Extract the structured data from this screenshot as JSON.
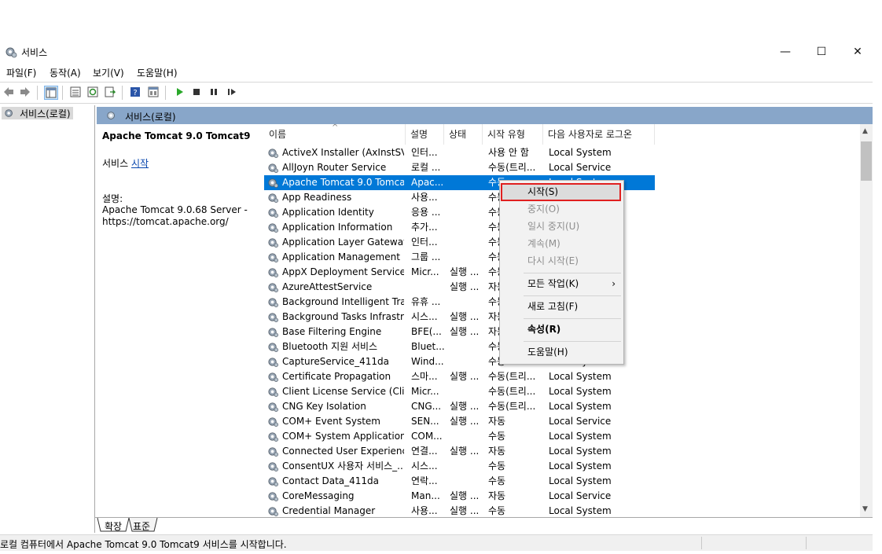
{
  "window": {
    "title": "서비스",
    "minimize": "—",
    "maximize": "☐",
    "close": "✕"
  },
  "menu": [
    "파일(F)",
    "동작(A)",
    "보기(V)",
    "도움말(H)"
  ],
  "tree": {
    "root_label": "서비스(로컬)"
  },
  "panel": {
    "header_label": "서비스(로컬)"
  },
  "detail": {
    "service_name": "Apache Tomcat 9.0 Tomcat9",
    "action_prefix": "서비스",
    "action_link": "시작",
    "desc_label": "설명:",
    "desc_line1": "Apache Tomcat 9.0.68 Server -",
    "desc_line2": "https://tomcat.apache.org/"
  },
  "columns": {
    "name": "이름",
    "desc": "설명",
    "status": "상태",
    "startup": "시작 유형",
    "logon": "다음 사용자로 로그온"
  },
  "services": [
    {
      "name": "ActiveX Installer (AxInstSV)",
      "desc": "인터...",
      "status": "",
      "startup": "사용 안 함",
      "logon": "Local System"
    },
    {
      "name": "AllJoyn Router Service",
      "desc": "로컬 ...",
      "status": "",
      "startup": "수동(트리...",
      "logon": "Local Service"
    },
    {
      "name": "Apache Tomcat 9.0 Tomcat9",
      "desc": "Apac...",
      "status": "",
      "startup": "수동",
      "logon": "Local System",
      "selected": true
    },
    {
      "name": "App Readiness",
      "desc": "사용...",
      "status": "",
      "startup": "수동",
      "logon": ""
    },
    {
      "name": "Application Identity",
      "desc": "응용 ...",
      "status": "",
      "startup": "수동",
      "logon": ""
    },
    {
      "name": "Application Information",
      "desc": "추가...",
      "status": "",
      "startup": "수동",
      "logon": ""
    },
    {
      "name": "Application Layer Gateway ...",
      "desc": "인터...",
      "status": "",
      "startup": "수동",
      "logon": ""
    },
    {
      "name": "Application Management",
      "desc": "그룹 ...",
      "status": "",
      "startup": "수동",
      "logon": ""
    },
    {
      "name": "AppX Deployment Service ...",
      "desc": "Micr...",
      "status": "실행 ...",
      "startup": "수동",
      "logon": ""
    },
    {
      "name": "AzureAttestService",
      "desc": "",
      "status": "실행 ...",
      "startup": "자동",
      "logon": ""
    },
    {
      "name": "Background Intelligent Tra...",
      "desc": "유휴 ...",
      "status": "",
      "startup": "수동",
      "logon": ""
    },
    {
      "name": "Background Tasks Infrastru...",
      "desc": "시스...",
      "status": "실행 ...",
      "startup": "자동",
      "logon": ""
    },
    {
      "name": "Base Filtering Engine",
      "desc": "BFE(...",
      "status": "실행 ...",
      "startup": "자동",
      "logon": ""
    },
    {
      "name": "Bluetooth 지원 서비스",
      "desc": "Bluet...",
      "status": "",
      "startup": "수동",
      "logon": ""
    },
    {
      "name": "CaptureService_411da",
      "desc": "Wind...",
      "status": "",
      "startup": "수동",
      "logon": "Local System"
    },
    {
      "name": "Certificate Propagation",
      "desc": "스마...",
      "status": "실행 ...",
      "startup": "수동(트리...",
      "logon": "Local System"
    },
    {
      "name": "Client License Service (Clip...",
      "desc": "Micr...",
      "status": "",
      "startup": "수동(트리...",
      "logon": "Local System"
    },
    {
      "name": "CNG Key Isolation",
      "desc": "CNG...",
      "status": "실행 ...",
      "startup": "수동(트리...",
      "logon": "Local System"
    },
    {
      "name": "COM+ Event System",
      "desc": "SEN...",
      "status": "실행 ...",
      "startup": "자동",
      "logon": "Local Service"
    },
    {
      "name": "COM+ System Application",
      "desc": "COM...",
      "status": "",
      "startup": "수동",
      "logon": "Local System"
    },
    {
      "name": "Connected User Experience...",
      "desc": "연결...",
      "status": "실행 ...",
      "startup": "자동",
      "logon": "Local System"
    },
    {
      "name": "ConsentUX 사용자 서비스_...",
      "desc": "시스...",
      "status": "",
      "startup": "수동",
      "logon": "Local System"
    },
    {
      "name": "Contact Data_411da",
      "desc": "연락...",
      "status": "",
      "startup": "수동",
      "logon": "Local System"
    },
    {
      "name": "CoreMessaging",
      "desc": "Man...",
      "status": "실행 ...",
      "startup": "자동",
      "logon": "Local Service"
    },
    {
      "name": "Credential Manager",
      "desc": "사용...",
      "status": "실행 ...",
      "startup": "수동",
      "logon": "Local System"
    }
  ],
  "context_menu": {
    "start": "시작(S)",
    "stop": "중지(O)",
    "pause": "일시 중지(U)",
    "resume": "계속(M)",
    "restart": "다시 시작(E)",
    "all_tasks": "모든 작업(K)",
    "refresh": "새로 고침(F)",
    "properties": "속성(R)",
    "help": "도움말(H)"
  },
  "tabs": {
    "extended": "확장",
    "standard": "표준"
  },
  "statusbar": {
    "text": "로컬 컴퓨터에서 Apache Tomcat 9.0 Tomcat9 서비스를 시작합니다."
  },
  "colors": {
    "selection": "#0078d7",
    "panel_header": "#88a6c9",
    "highlight_border": "#e02020"
  }
}
